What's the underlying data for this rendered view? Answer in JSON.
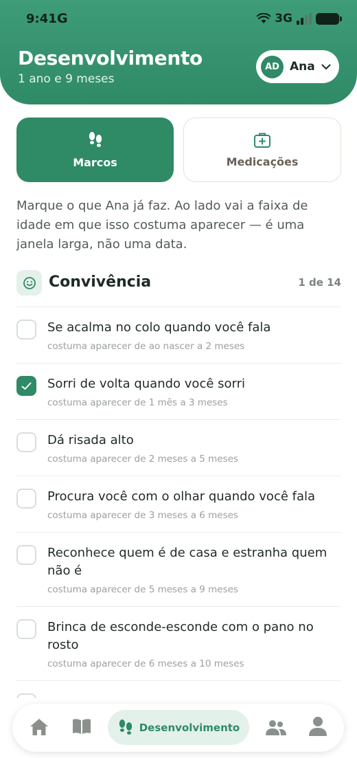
{
  "status": {
    "time": "9:41",
    "carrier_logo": "G",
    "network": "3G"
  },
  "header": {
    "title": "Desenvolvimento",
    "subtitle": "1 ano e 9 meses"
  },
  "profile": {
    "initials": "AD",
    "name": "Ana"
  },
  "tabs": [
    {
      "label": "Marcos",
      "icon": "footprints-icon",
      "active": true
    },
    {
      "label": "Medicações",
      "icon": "medkit-icon",
      "active": false
    }
  ],
  "intro": "Marque o que Ana já faz. Ao lado vai a faixa de idade em que isso costuma aparecer — é uma janela larga, não uma data.",
  "section": {
    "icon": "smiley-icon",
    "title": "Convivência",
    "count": "1 de 14"
  },
  "milestones": [
    {
      "title": "Se acalma no colo quando você fala",
      "range": "costuma aparecer de ao nascer a 2 meses",
      "checked": false
    },
    {
      "title": "Sorri de volta quando você sorri",
      "range": "costuma aparecer de 1 mês a 3 meses",
      "checked": true
    },
    {
      "title": "Dá risada alto",
      "range": "costuma aparecer de 2 meses a 5 meses",
      "checked": false
    },
    {
      "title": "Procura você com o olhar quando você fala",
      "range": "costuma aparecer de 3 meses a 6 meses",
      "checked": false
    },
    {
      "title": "Reconhece quem é de casa e estranha quem não é",
      "range": "costuma aparecer de 5 meses a 9 meses",
      "checked": false
    },
    {
      "title": "Brinca de esconde-esconde com o pano no rosto",
      "range": "costuma aparecer de 6 meses a 10 meses",
      "checked": false
    }
  ],
  "nav": {
    "items": [
      {
        "icon": "home-icon"
      },
      {
        "icon": "book-icon"
      },
      {
        "icon": "footprints-icon",
        "label": "Desenvolvimento",
        "active": true
      },
      {
        "icon": "group-icon"
      },
      {
        "icon": "person-icon"
      }
    ]
  },
  "colors": {
    "primary": "#2f8a66",
    "primary_light": "#e3f1ea",
    "text": "#1f2a26",
    "muted": "#9aa19d"
  }
}
